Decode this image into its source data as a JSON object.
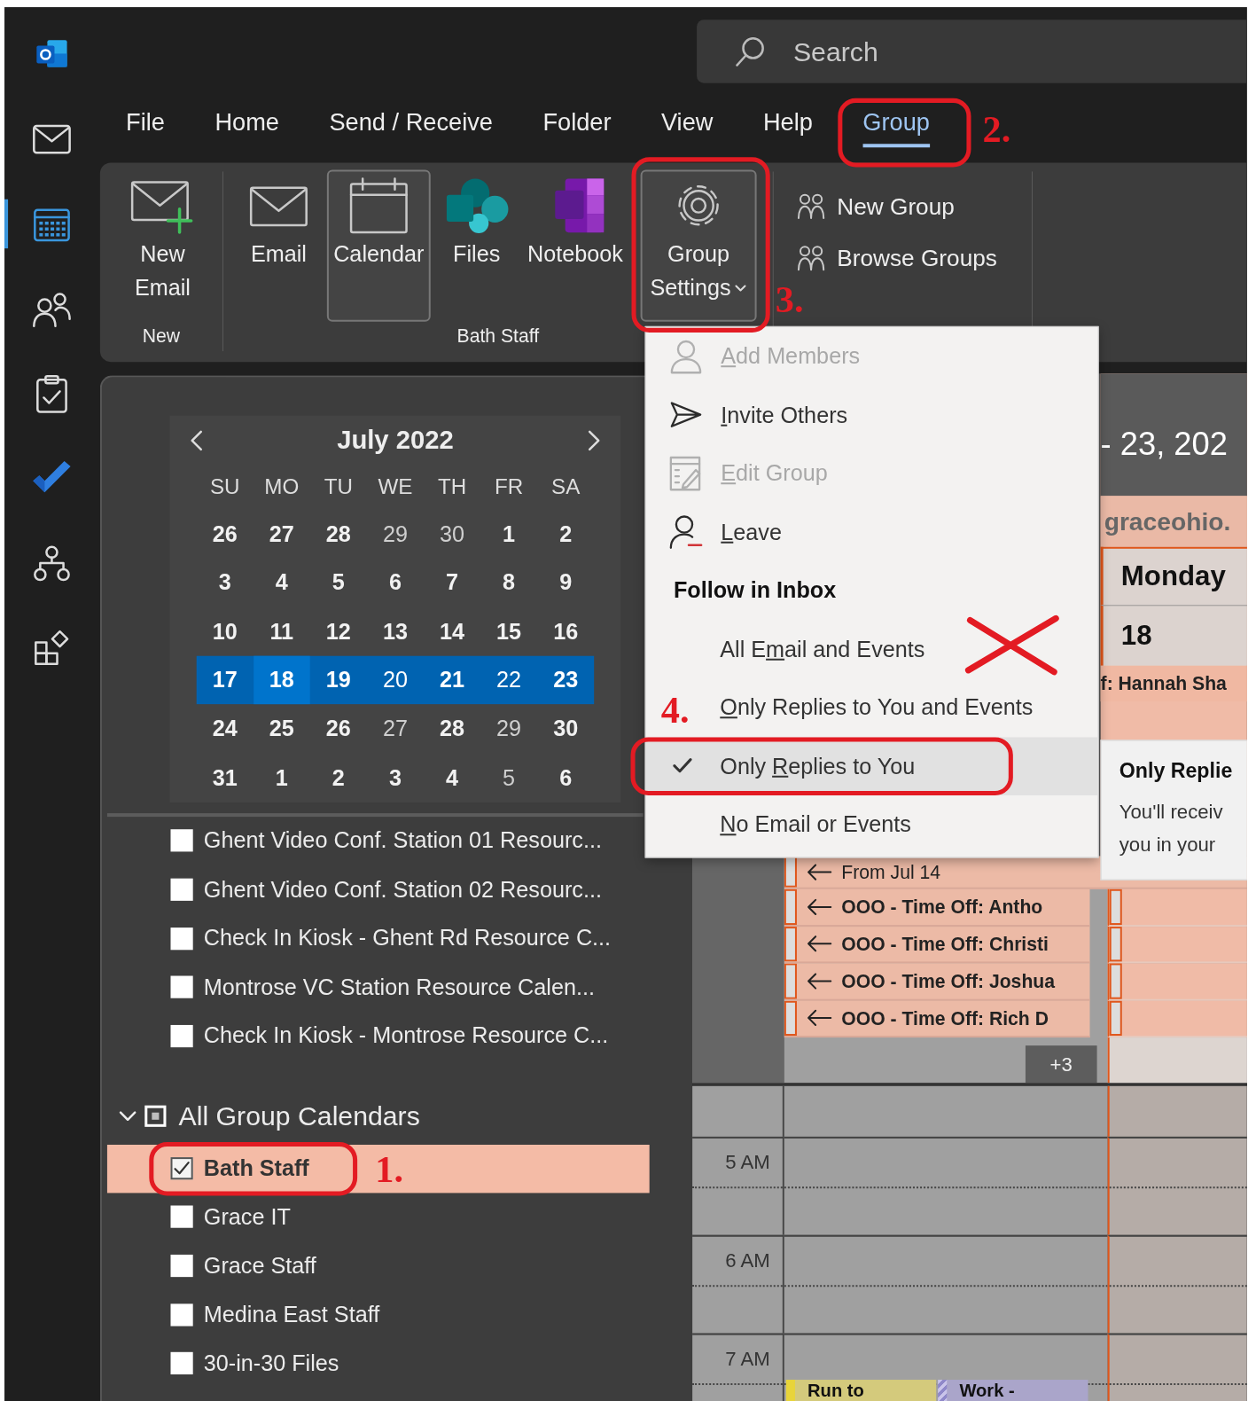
{
  "search": {
    "placeholder": "Search"
  },
  "rail": {
    "items": [
      {
        "kind": "mail",
        "selected": false
      },
      {
        "kind": "calendar",
        "selected": true
      },
      {
        "kind": "people",
        "selected": false
      },
      {
        "kind": "tasks",
        "selected": false
      },
      {
        "kind": "todo",
        "selected": false
      },
      {
        "kind": "groups",
        "selected": false
      },
      {
        "kind": "apps",
        "selected": false
      }
    ]
  },
  "menu_tabs": [
    {
      "label": "File",
      "selected": false
    },
    {
      "label": "Home",
      "selected": false
    },
    {
      "label": "Send / Receive",
      "selected": false
    },
    {
      "label": "Folder",
      "selected": false
    },
    {
      "label": "View",
      "selected": false
    },
    {
      "label": "Help",
      "selected": false
    },
    {
      "label": "Group",
      "selected": true
    }
  ],
  "ribbon": {
    "groups": [
      {
        "label": "New",
        "buttons": [
          {
            "kind": "new-email",
            "lines": [
              "New",
              "Email"
            ],
            "pressed": false,
            "dropdown": false
          }
        ]
      },
      {
        "label": "Bath Staff",
        "buttons": [
          {
            "kind": "email",
            "lines": [
              "Email"
            ],
            "pressed": false,
            "dropdown": false
          },
          {
            "kind": "calendar",
            "lines": [
              "Calendar"
            ],
            "pressed": true,
            "dropdown": false
          },
          {
            "kind": "files",
            "lines": [
              "Files"
            ],
            "pressed": false,
            "dropdown": false
          },
          {
            "kind": "notebook",
            "lines": [
              "Notebook"
            ],
            "pressed": false,
            "dropdown": false
          },
          {
            "kind": "settings",
            "lines": [
              "Group",
              "Settings"
            ],
            "pressed": true,
            "dropdown": true
          }
        ]
      },
      {
        "small_buttons": [
          {
            "label": "New Group"
          },
          {
            "label": "Browse Groups"
          }
        ]
      }
    ]
  },
  "mini_calendar": {
    "title": "July 2022",
    "weekdays": [
      "SU",
      "MO",
      "TU",
      "WE",
      "TH",
      "FR",
      "SA"
    ],
    "weeks": [
      {
        "selected": false,
        "days": [
          {
            "label": "26",
            "bold": true,
            "selected": false
          },
          {
            "label": "27",
            "bold": true,
            "selected": false
          },
          {
            "label": "28",
            "bold": true,
            "selected": false
          },
          {
            "label": "29",
            "bold": false,
            "selected": false
          },
          {
            "label": "30",
            "bold": false,
            "selected": false
          },
          {
            "label": "1",
            "bold": true,
            "selected": false
          },
          {
            "label": "2",
            "bold": true,
            "selected": false
          }
        ]
      },
      {
        "selected": false,
        "days": [
          {
            "label": "3",
            "bold": true,
            "selected": false
          },
          {
            "label": "4",
            "bold": true,
            "selected": false
          },
          {
            "label": "5",
            "bold": true,
            "selected": false
          },
          {
            "label": "6",
            "bold": true,
            "selected": false
          },
          {
            "label": "7",
            "bold": true,
            "selected": false
          },
          {
            "label": "8",
            "bold": true,
            "selected": false
          },
          {
            "label": "9",
            "bold": true,
            "selected": false
          }
        ]
      },
      {
        "selected": false,
        "days": [
          {
            "label": "10",
            "bold": true,
            "selected": false
          },
          {
            "label": "11",
            "bold": true,
            "selected": false
          },
          {
            "label": "12",
            "bold": true,
            "selected": false
          },
          {
            "label": "13",
            "bold": true,
            "selected": false
          },
          {
            "label": "14",
            "bold": true,
            "selected": false
          },
          {
            "label": "15",
            "bold": true,
            "selected": false
          },
          {
            "label": "16",
            "bold": true,
            "selected": false
          }
        ]
      },
      {
        "selected": true,
        "days": [
          {
            "label": "17",
            "bold": true,
            "selected": false
          },
          {
            "label": "18",
            "bold": true,
            "selected": true
          },
          {
            "label": "19",
            "bold": true,
            "selected": false
          },
          {
            "label": "20",
            "bold": false,
            "selected": false
          },
          {
            "label": "21",
            "bold": true,
            "selected": false
          },
          {
            "label": "22",
            "bold": false,
            "selected": false
          },
          {
            "label": "23",
            "bold": true,
            "selected": false
          }
        ]
      },
      {
        "selected": false,
        "days": [
          {
            "label": "24",
            "bold": true,
            "selected": false
          },
          {
            "label": "25",
            "bold": true,
            "selected": false
          },
          {
            "label": "26",
            "bold": true,
            "selected": false
          },
          {
            "label": "27",
            "bold": false,
            "selected": false
          },
          {
            "label": "28",
            "bold": true,
            "selected": false
          },
          {
            "label": "29",
            "bold": false,
            "selected": false
          },
          {
            "label": "30",
            "bold": true,
            "selected": false
          }
        ]
      },
      {
        "selected": false,
        "days": [
          {
            "label": "31",
            "bold": true,
            "selected": false
          },
          {
            "label": "1",
            "bold": true,
            "selected": false
          },
          {
            "label": "2",
            "bold": true,
            "selected": false
          },
          {
            "label": "3",
            "bold": true,
            "selected": false
          },
          {
            "label": "4",
            "bold": true,
            "selected": false
          },
          {
            "label": "5",
            "bold": false,
            "selected": false
          },
          {
            "label": "6",
            "bold": true,
            "selected": false
          }
        ]
      }
    ]
  },
  "calendar_list": {
    "items": [
      {
        "label": "Ghent Video Conf. Station 01 Resourc...",
        "checked": false
      },
      {
        "label": "Ghent Video Conf. Station 02 Resourc...",
        "checked": false
      },
      {
        "label": "Check In Kiosk - Ghent Rd Resource C...",
        "checked": false
      },
      {
        "label": "Montrose VC Station Resource Calen...",
        "checked": false
      },
      {
        "label": "Check In Kiosk - Montrose Resource C...",
        "checked": false
      }
    ],
    "groups": [
      {
        "label": "All Group Calendars",
        "expanded": true,
        "partial": true,
        "items": [
          {
            "label": "Bath Staff",
            "checked": true,
            "selected": true
          },
          {
            "label": "Grace IT",
            "checked": false,
            "selected": false
          },
          {
            "label": "Grace Staff",
            "checked": false,
            "selected": false
          },
          {
            "label": "Medina East Staff",
            "checked": false,
            "selected": false
          },
          {
            "label": "30-in-30 Files",
            "checked": false,
            "selected": false
          }
        ]
      }
    ]
  },
  "view": {
    "date_range": "- 23, 202",
    "account": "graceohio.",
    "day_name": "Monday",
    "day_number": "18",
    "top_event": "f: Hannah Sha",
    "all_day": [
      {
        "title": "From Jul 14",
        "continued": true,
        "bold": false
      },
      {
        "title": "OOO - Time Off: Antho",
        "continued": true,
        "bold": true
      },
      {
        "title": "OOO - Time Off: Christi",
        "continued": true,
        "bold": true
      },
      {
        "title": "OOO - Time Off: Joshua",
        "continued": true,
        "bold": true
      },
      {
        "title": "OOO - Time Off: Rich D",
        "continued": true,
        "bold": true
      }
    ],
    "more": "+3",
    "hours": [
      {
        "label": "5 AM"
      },
      {
        "label": "6 AM"
      },
      {
        "label": "7 AM",
        "events": [
          {
            "title": "Run to",
            "kind": "busy",
            "color": "#d4ca7c"
          },
          {
            "title": "Work -",
            "kind": "tentative",
            "color": "#aaa5ca"
          }
        ]
      }
    ]
  },
  "group_menu": {
    "items": [
      {
        "kind": "add-members",
        "key": "A",
        "rest": "dd Members",
        "disabled": true
      },
      {
        "kind": "invite",
        "key": "I",
        "rest": "nvite Others",
        "disabled": false
      },
      {
        "kind": "edit",
        "key": "E",
        "rest": "dit Group",
        "disabled": true
      },
      {
        "kind": "leave",
        "key": "L",
        "rest": "eave",
        "disabled": false
      }
    ],
    "section": "Follow in Inbox",
    "options": [
      {
        "lead": "All E",
        "key": "m",
        "rest": "ail and Events",
        "selected": false
      },
      {
        "key": "O",
        "rest": "nly Replies to You and Events",
        "selected": false
      },
      {
        "lead": "Only ",
        "key": "R",
        "rest": "eplies to You",
        "selected": true
      },
      {
        "key": "N",
        "rest": "o Email or Events",
        "selected": false
      }
    ]
  },
  "tooltip": {
    "title": "Only Replie",
    "lines": [
      "You'll receiv",
      "you in your"
    ]
  },
  "annotations": [
    {
      "label": "1."
    },
    {
      "label": "2."
    },
    {
      "label": "3."
    },
    {
      "label": "4."
    }
  ]
}
